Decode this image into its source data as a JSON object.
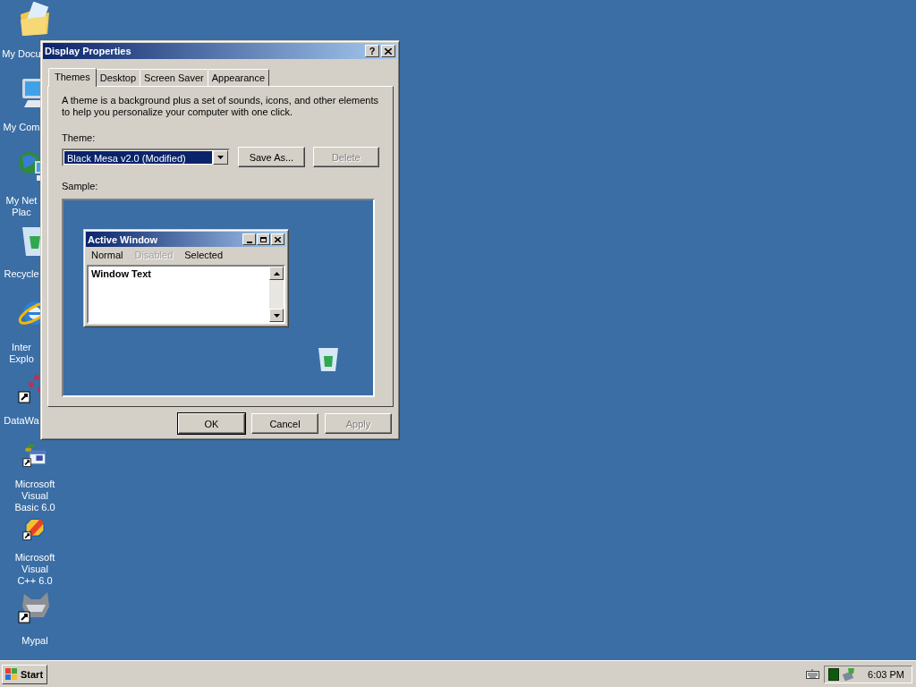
{
  "desktop": {
    "icons": [
      {
        "kind": "documents",
        "label": "My Docu",
        "covered": true
      },
      {
        "kind": "computer",
        "label": "My Com",
        "covered": true
      },
      {
        "kind": "network",
        "label": "My Net\nPlac",
        "covered": true
      },
      {
        "kind": "recycle",
        "label": "Recycle",
        "covered": true
      },
      {
        "kind": "browser",
        "label": "Inter\nExplo",
        "covered": true
      },
      {
        "kind": "dots",
        "label": "DataWa",
        "covered": true
      },
      {
        "kind": "calendar",
        "label": "Microsoft Visual\nBasic 6.0",
        "covered": false
      },
      {
        "kind": "tool",
        "label": "Microsoft Visual\nC++ 6.0",
        "covered": false
      },
      {
        "kind": "raccoon",
        "label": "Mypal",
        "covered": false
      }
    ]
  },
  "dialog": {
    "title": "Display Properties",
    "help": "?",
    "tabs": [
      {
        "label": "Themes",
        "selected": true
      },
      {
        "label": "Desktop",
        "selected": false
      },
      {
        "label": "Screen Saver",
        "selected": false
      },
      {
        "label": "Appearance",
        "selected": false
      }
    ],
    "description": "A theme is a background plus a set of sounds, icons, and other elements to help you personalize your computer with one click.",
    "theme_label": "Theme:",
    "theme_select": {
      "value": "Black Mesa v2.0 (Modified)"
    },
    "theme_buttons": [
      {
        "label": "Save As...",
        "disabled": false
      },
      {
        "label": "Delete",
        "disabled": true
      }
    ],
    "sample_label": "Sample:",
    "sample": {
      "window_title": "Active Window",
      "menu": [
        {
          "label": "Normal",
          "disabled": false
        },
        {
          "label": "Disabled",
          "disabled": true
        },
        {
          "label": "Selected",
          "disabled": false
        }
      ],
      "window_text": "Window Text"
    },
    "footer_buttons": [
      {
        "label": "OK",
        "disabled": false,
        "default": true
      },
      {
        "label": "Cancel",
        "disabled": false,
        "default": false
      },
      {
        "label": "Apply",
        "disabled": true,
        "default": false
      }
    ]
  },
  "taskbar": {
    "start": "Start",
    "clock": "6:03 PM"
  }
}
